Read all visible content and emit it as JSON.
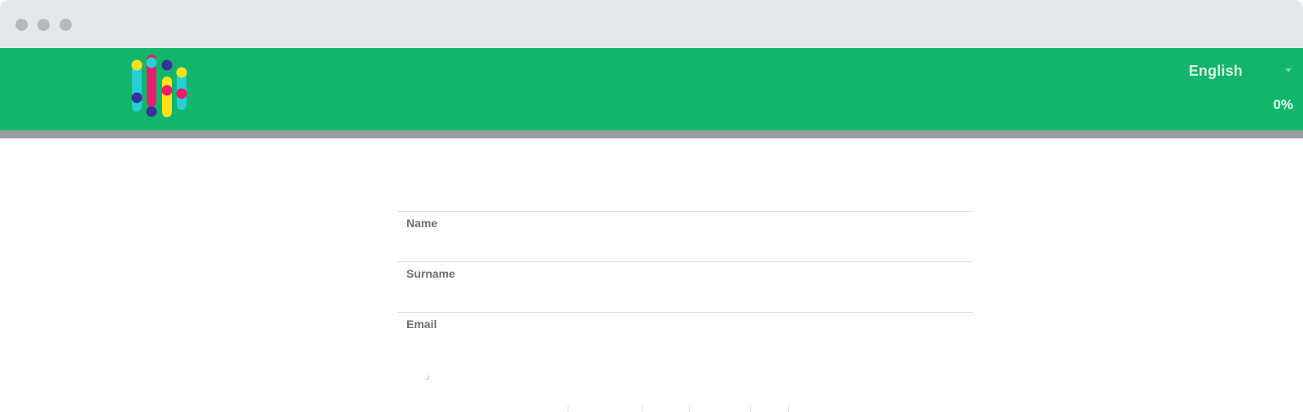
{
  "theme": {
    "brand": "#13b56a",
    "track": "#9a9c9b"
  },
  "window": {
    "controls": [
      "close-dot",
      "minimize-dot",
      "maximize-dot"
    ]
  },
  "header": {
    "logo_icon": "bars-and-dots-logo",
    "language": {
      "selected": "English",
      "icon": "chevron-down-icon"
    },
    "progress": {
      "label": "0%",
      "value": 0
    }
  },
  "form": {
    "fields": [
      {
        "label": "Name",
        "value": "",
        "placeholder": ""
      },
      {
        "label": "Surname",
        "value": "",
        "placeholder": ""
      },
      {
        "label": "Email",
        "value": "",
        "placeholder": ""
      }
    ]
  }
}
